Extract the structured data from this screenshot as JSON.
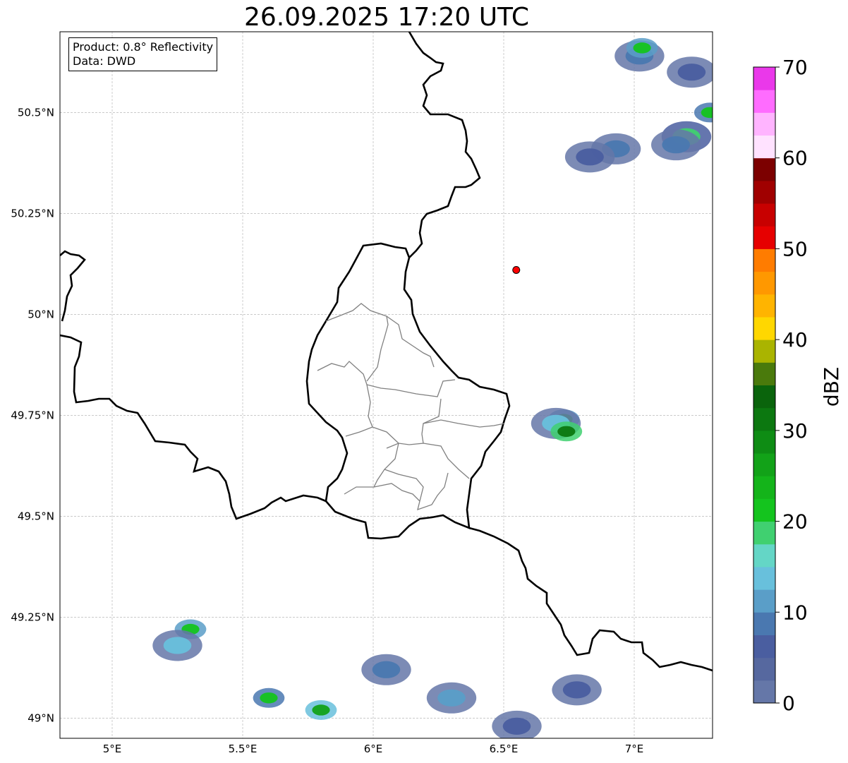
{
  "title": "26.09.2025 17:20 UTC",
  "info": {
    "product": "Product: 0.8° Reflectivity",
    "data": "Data: DWD"
  },
  "axes": {
    "lon_ticks": [
      {
        "value": 5.0,
        "label": "5°E"
      },
      {
        "value": 5.5,
        "label": "5.5°E"
      },
      {
        "value": 6.0,
        "label": "6°E"
      },
      {
        "value": 6.5,
        "label": "6.5°E"
      },
      {
        "value": 7.0,
        "label": "7°E"
      }
    ],
    "lat_ticks": [
      {
        "value": 49.0,
        "label": "49°N"
      },
      {
        "value": 49.25,
        "label": "49.25°N"
      },
      {
        "value": 49.5,
        "label": "49.5°N"
      },
      {
        "value": 49.75,
        "label": "49.75°N"
      },
      {
        "value": 50.0,
        "label": "50°N"
      },
      {
        "value": 50.25,
        "label": "50.25°N"
      },
      {
        "value": 50.5,
        "label": "50.5°N"
      }
    ],
    "lon_range": [
      4.8,
      7.3
    ],
    "lat_range": [
      48.95,
      50.7
    ],
    "grid": true
  },
  "radar_site": {
    "lon": 6.548,
    "lat": 50.11,
    "color": "#ff0000"
  },
  "colorbar": {
    "label": "dBZ",
    "min": 0,
    "max": 70,
    "ticks": [
      {
        "value": 0,
        "label": "0"
      },
      {
        "value": 10,
        "label": "10"
      },
      {
        "value": 20,
        "label": "20"
      },
      {
        "value": 30,
        "label": "30"
      },
      {
        "value": 40,
        "label": "40"
      },
      {
        "value": 50,
        "label": "50"
      },
      {
        "value": 60,
        "label": "60"
      },
      {
        "value": 70,
        "label": "70"
      }
    ],
    "colors": [
      "#6577a8",
      "#56689f",
      "#4a5ea0",
      "#4a78b0",
      "#5a9ec8",
      "#68c0dc",
      "#64d6c6",
      "#40d070",
      "#14c41e",
      "#14b41a",
      "#12a218",
      "#0e8c14",
      "#0c7810",
      "#0a640c",
      "#4a7a0c",
      "#aab400",
      "#ffd700",
      "#ffb400",
      "#ff9800",
      "#ff7c00",
      "#e60000",
      "#c80000",
      "#a00000",
      "#7c0000",
      "#ffe2ff",
      "#ffb4ff",
      "#ff6cff",
      "#ea38ea"
    ]
  },
  "precip_cells": [
    {
      "lon": 7.02,
      "lat": 50.64,
      "dbz": 8
    },
    {
      "lon": 7.03,
      "lat": 50.66,
      "dbz": 22
    },
    {
      "lon": 7.22,
      "lat": 50.6,
      "dbz": 6
    },
    {
      "lon": 7.29,
      "lat": 50.5,
      "dbz": 20
    },
    {
      "lon": 6.93,
      "lat": 50.41,
      "dbz": 8
    },
    {
      "lon": 6.83,
      "lat": 50.39,
      "dbz": 5
    },
    {
      "lon": 7.2,
      "lat": 50.44,
      "dbz": 18
    },
    {
      "lon": 7.16,
      "lat": 50.42,
      "dbz": 8
    },
    {
      "lon": 6.73,
      "lat": 49.74,
      "dbz": 24
    },
    {
      "lon": 6.7,
      "lat": 49.73,
      "dbz": 14
    },
    {
      "lon": 6.74,
      "lat": 49.71,
      "dbz": 30
    },
    {
      "lon": 6.78,
      "lat": 49.07,
      "dbz": 6
    },
    {
      "lon": 5.3,
      "lat": 49.22,
      "dbz": 22
    },
    {
      "lon": 5.25,
      "lat": 49.18,
      "dbz": 14
    },
    {
      "lon": 5.6,
      "lat": 49.05,
      "dbz": 20
    },
    {
      "lon": 5.8,
      "lat": 49.02,
      "dbz": 26
    },
    {
      "lon": 6.05,
      "lat": 49.12,
      "dbz": 8
    },
    {
      "lon": 6.3,
      "lat": 49.05,
      "dbz": 10
    },
    {
      "lon": 6.55,
      "lat": 48.98,
      "dbz": 6
    }
  ]
}
